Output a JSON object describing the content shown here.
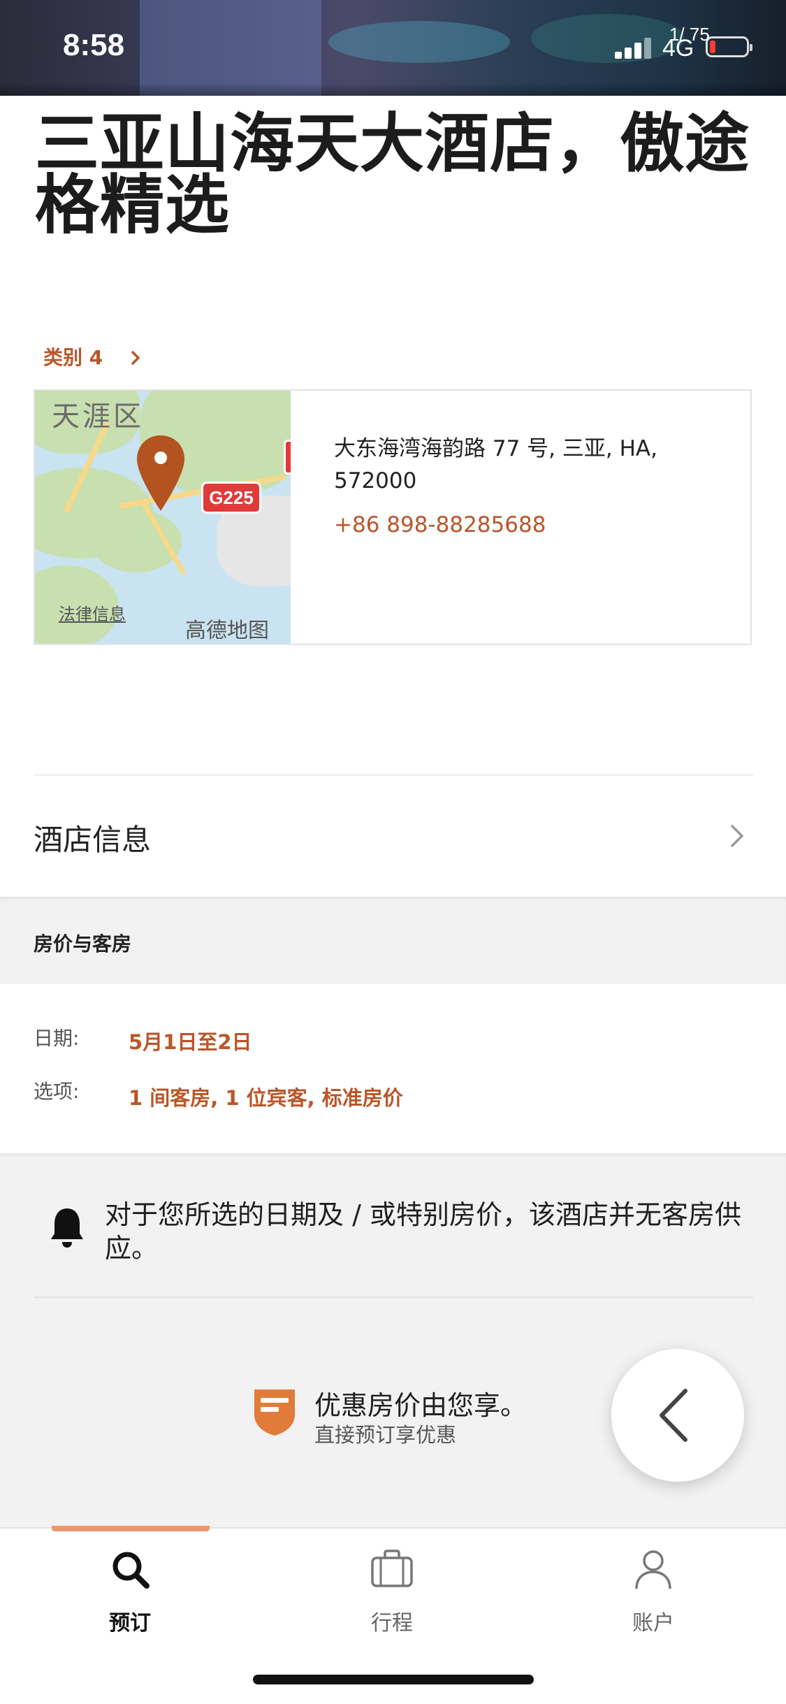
{
  "status_bar": {
    "time": "8:58",
    "network": "4G",
    "photo_counter": "1/ 75",
    "battery_color": "#ff3b30"
  },
  "hotel": {
    "title": "三亚山海天大酒店，傲途格精选",
    "category": "类别 4",
    "address": "大东海湾海韵路 77 号, 三亚, HA, 572000",
    "phone": "+86 898-88285688"
  },
  "map": {
    "district_label": "天涯区",
    "highway_label": "G225",
    "legal_link": "法律信息",
    "provider": "高德地图"
  },
  "hotel_info": {
    "label": "酒店信息"
  },
  "rooms_section": {
    "heading": "房价与客房",
    "date_label": "日期:",
    "date_value": "5月1日至2日",
    "options_label": "选项:",
    "options_value": "1 间客房, 1 位宾客, 标准房价"
  },
  "notice": {
    "text": "对于您所选的日期及 / 或特别房价，该酒店并无客房供应。",
    "icon": "bell-icon"
  },
  "promo": {
    "title": "优惠房价由您享。",
    "subtitle": "直接预订享优惠",
    "icon": "shield-badge-icon",
    "accent": "#e07b39"
  },
  "tabs": [
    {
      "label": "预订",
      "icon": "search-icon",
      "active": true
    },
    {
      "label": "行程",
      "icon": "suitcase-icon",
      "active": false
    },
    {
      "label": "账户",
      "icon": "person-icon",
      "active": false
    }
  ],
  "colors": {
    "accent": "#b9562a",
    "tab_indicator": "#f0956b"
  }
}
